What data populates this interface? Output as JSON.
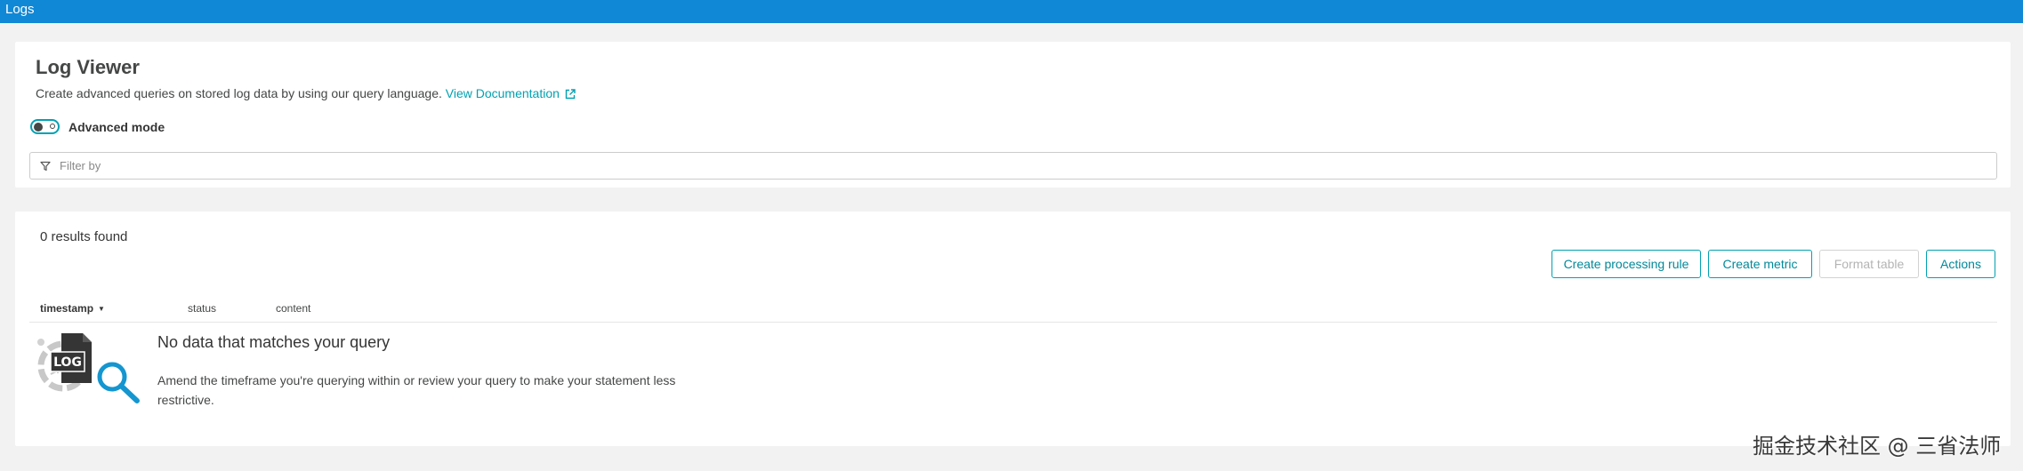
{
  "topbar": {
    "title": "Logs"
  },
  "viewer": {
    "title": "Log Viewer",
    "description": "Create advanced queries on stored log data by using our query language.",
    "doc_link": "View Documentation",
    "advanced_mode_label": "Advanced mode",
    "advanced_mode_on": false,
    "filter_placeholder": "Filter by",
    "filter_value": ""
  },
  "results": {
    "count_text": "0 results found",
    "buttons": {
      "create_rule": "Create processing rule",
      "create_metric": "Create metric",
      "format_table": "Format table",
      "actions": "Actions"
    },
    "columns": [
      "timestamp",
      "status",
      "content"
    ],
    "empty": {
      "title": "No data that matches your query",
      "description": "Amend the timeframe you're querying within or review your query to make your statement less restrictive.",
      "illustration_text": "LOG"
    }
  },
  "icons": {
    "external_link": "external-link-icon",
    "filter": "filter-icon",
    "sort": "sort-desc-icon",
    "empty_state": "log-search-icon"
  },
  "colors": {
    "topbar": "#1088d6",
    "accent": "#00a1b2",
    "background": "#f2f2f2"
  },
  "watermark": "掘金技术社区 @ 三省法师"
}
